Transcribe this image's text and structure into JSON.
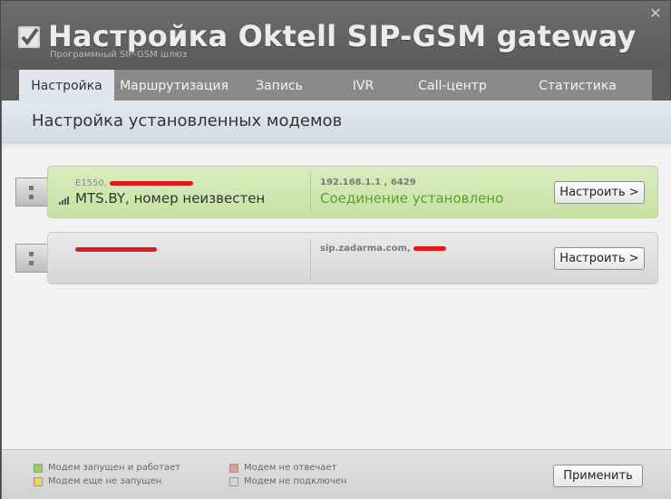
{
  "window": {
    "title": "Настройка Oktell SIP-GSM gateway",
    "subtitle": "Программный SIP-GSM шлюз",
    "close_symbol": "✕"
  },
  "tabs": [
    {
      "label": "Настройка",
      "active": true
    },
    {
      "label": "Маршрутизация",
      "active": false
    },
    {
      "label": "Запись",
      "active": false
    },
    {
      "label": "IVR",
      "active": false
    },
    {
      "label": "Call-центр",
      "active": false
    },
    {
      "label": "Статистика",
      "active": false
    }
  ],
  "section": {
    "title": "Настройка установленных модемов"
  },
  "modems": [
    {
      "model": "E1550,",
      "operator": "MTS.BY, номер неизвестен",
      "host": "192.168.1.1  , 6429",
      "status": "Соединение установлено",
      "state_color": "#c6e2a4",
      "configure_label": "Настроить >"
    },
    {
      "model": "",
      "operator": "",
      "host": "sip.zadarma.com,",
      "status": "",
      "state_color": "#d7d7d7",
      "configure_label": "Настроить >"
    }
  ],
  "legend": [
    {
      "label": "Модем запущен и работает",
      "color": "#9ccc5e"
    },
    {
      "label": "Модем еще не запущен",
      "color": "#e8d46a"
    },
    {
      "label": "Модем не отвечает",
      "color": "#e59b96"
    },
    {
      "label": "Модем не подключен",
      "color": "#d6d6d6"
    }
  ],
  "footer": {
    "apply_label": "Применить"
  }
}
